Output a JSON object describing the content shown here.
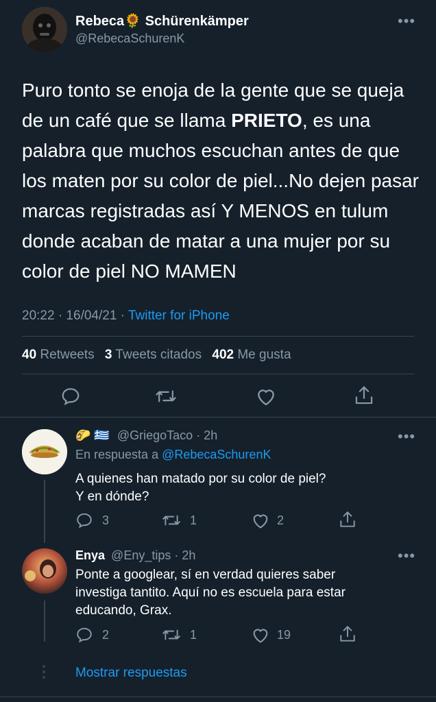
{
  "main_tweet": {
    "author_name": "Rebeca",
    "author_emoji": "🌻",
    "author_surname": "Schürenkämper",
    "handle": "@RebecaSchurenK",
    "text_part1": "Puro tonto se enoja de la gente que se queja  de un café que se llama ",
    "text_bold": "PRIETO",
    "text_part2": ", es una palabra que muchos escuchan antes de que los maten por su color de piel...No dejen pasar marcas registradas así Y MENOS en tulum donde acaban de matar a una mujer por su color de piel NO MAMEN",
    "timestamp": "20:22 · 16/04/21 · ",
    "source": "Twitter for iPhone",
    "stats": {
      "retweets_count": "40",
      "retweets_label": "Retweets",
      "quotes_count": "3",
      "quotes_label": "Tweets citados",
      "likes_count": "402",
      "likes_label": "Me gusta"
    }
  },
  "replies": [
    {
      "author_name": "🌮 🇬🇷",
      "handle": "@GriegoTaco",
      "time": "· 2h",
      "reply_to_label": "En respuesta a ",
      "reply_to_handle": "@RebecaSchurenK",
      "text_line1": "A quienes han matado por su color de piel?",
      "text_line2": "Y en dónde?",
      "reply_count": "3",
      "retweet_count": "1",
      "like_count": "2"
    },
    {
      "author_name": "Enya",
      "handle": "@Eny_tips",
      "time": "· 2h",
      "text_line1": "Ponte a googlear, sí en verdad quieres saber",
      "text_line2": "investiga tantito. Aquí no es escuela para estar",
      "text_line3": "educando, Grax.",
      "reply_count": "2",
      "retweet_count": "1",
      "like_count": "19"
    }
  ],
  "show_replies_label": "Mostrar respuestas",
  "colors": {
    "background": "#15202b",
    "accent": "#1d9bf0",
    "muted": "#8899a6",
    "divider": "#38444d"
  }
}
